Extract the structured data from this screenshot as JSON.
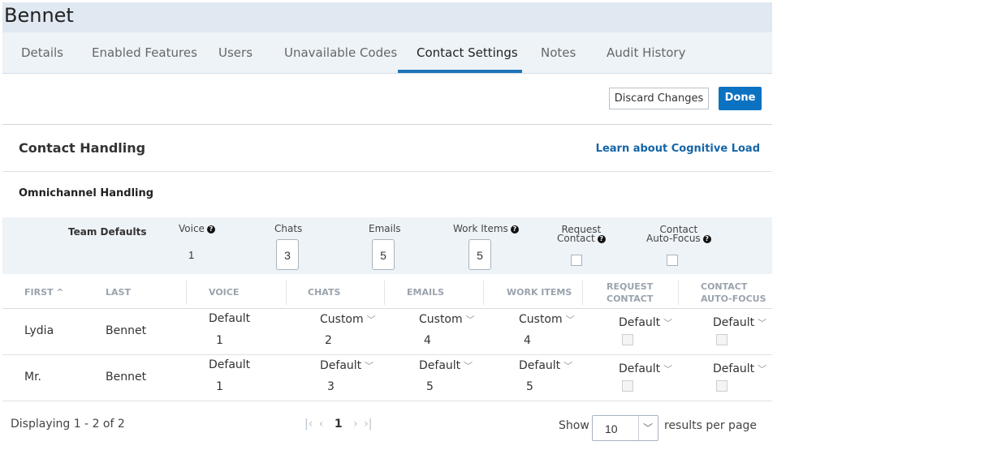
{
  "window": {
    "title": "Bennet"
  },
  "tabs": [
    {
      "label": "Details"
    },
    {
      "label": "Enabled Features"
    },
    {
      "label": "Users"
    },
    {
      "label": "Unavailable Codes"
    },
    {
      "label": "Contact Settings",
      "active": true
    },
    {
      "label": "Notes"
    },
    {
      "label": "Audit History"
    }
  ],
  "toolbar": {
    "discard_label": "Discard Changes",
    "done_label": "Done"
  },
  "section": {
    "title": "Contact Handling",
    "link": "Learn about Cognitive Load"
  },
  "omnichannel": {
    "title": "Omnichannel Handling",
    "team_defaults_label": "Team Defaults",
    "voice_label": "Voice",
    "voice_value": "1",
    "chats_label": "Chats",
    "chats_value": "3",
    "emails_label": "Emails",
    "emails_value": "5",
    "workitems_label": "Work Items",
    "workitems_value": "5",
    "request_contact_label_1": "Request",
    "request_contact_label_2": "Contact",
    "autofocus_label_1": "Contact",
    "autofocus_label_2": "Auto-Focus"
  },
  "table": {
    "headers": {
      "first": "FIRST",
      "last": "LAST",
      "voice": "VOICE",
      "chats": "CHATS",
      "emails": "EMAILS",
      "workitems": "WORK ITEMS",
      "request_1": "REQUEST",
      "request_2": "CONTACT",
      "autofocus_1": "CONTACT",
      "autofocus_2": "AUTO-FOCUS"
    },
    "rows": [
      {
        "first": "Lydia",
        "last": "Bennet",
        "voice_mode": "Default",
        "voice_val": "1",
        "chats_mode": "Custom",
        "chats_val": "2",
        "emails_mode": "Custom",
        "emails_val": "4",
        "workitems_mode": "Custom",
        "workitems_val": "4",
        "request_mode": "Default",
        "autofocus_mode": "Default"
      },
      {
        "first": "Mr.",
        "last": "Bennet",
        "voice_mode": "Default",
        "voice_val": "1",
        "chats_mode": "Default",
        "chats_val": "3",
        "emails_mode": "Default",
        "emails_val": "5",
        "workitems_mode": "Default",
        "workitems_val": "5",
        "request_mode": "Default",
        "autofocus_mode": "Default"
      }
    ]
  },
  "footer": {
    "displaying": "Displaying 1 - 2 of 2",
    "current_page": "1",
    "show_label": "Show",
    "per_page_value": "10",
    "results_label": "results per page"
  },
  "icons": {
    "sort": "sort-asc-icon",
    "question": "question-icon",
    "chevron": "chevron-down-icon",
    "pager_first": "first-page-icon",
    "pager_prev": "prev-page-icon",
    "pager_next": "next-page-icon",
    "pager_last": "last-page-icon"
  },
  "colors": {
    "accent": "#0b72c1",
    "link": "#1565a8",
    "tab_underline": "#1f75b8"
  }
}
